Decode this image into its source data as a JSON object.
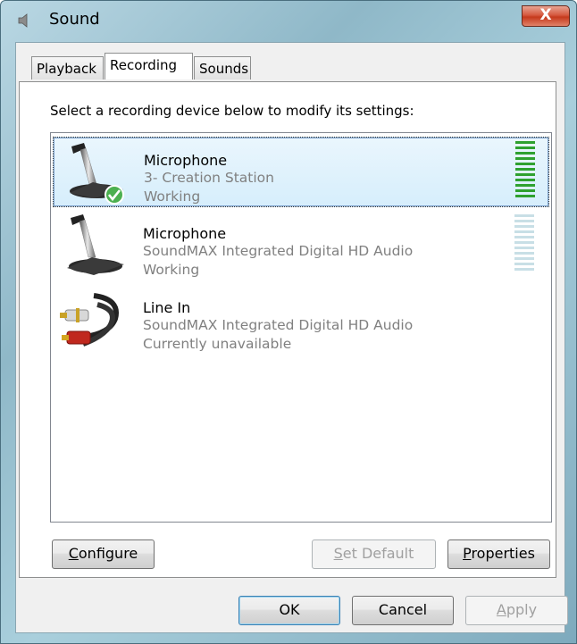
{
  "window": {
    "title": "Sound",
    "close_glyph": "X"
  },
  "tabs": [
    {
      "label": "Playback",
      "active": false
    },
    {
      "label": "Recording",
      "active": true
    },
    {
      "label": "Sounds",
      "active": false
    }
  ],
  "instructions": "Select a recording device below to modify its settings:",
  "devices": [
    {
      "name": "Microphone",
      "description": "3- Creation Station",
      "status": "Working",
      "icon": "microphone-icon",
      "default": true,
      "selected": true,
      "level": 1.0
    },
    {
      "name": "Microphone",
      "description": "SoundMAX Integrated Digital HD Audio",
      "status": "Working",
      "icon": "microphone-icon",
      "default": false,
      "selected": false,
      "level": 0.0
    },
    {
      "name": "Line In",
      "description": "SoundMAX Integrated Digital HD Audio",
      "status": "Currently unavailable",
      "icon": "rca-cable-icon",
      "default": false,
      "selected": false,
      "level": null
    }
  ],
  "panel_buttons": {
    "configure": {
      "prefix": "",
      "accel": "C",
      "rest": "onfigure"
    },
    "set_default": {
      "prefix": "",
      "accel": "S",
      "rest": "et Default"
    },
    "properties": {
      "prefix": "",
      "accel": "P",
      "rest": "roperties"
    }
  },
  "dialog_buttons": {
    "ok": "OK",
    "cancel": "Cancel",
    "apply": {
      "prefix": "",
      "accel": "A",
      "rest": "pply"
    }
  },
  "colors": {
    "meter_active": "#2fa12f",
    "meter_inactive": "#c8dfe6",
    "selection": "#d6eefc"
  }
}
